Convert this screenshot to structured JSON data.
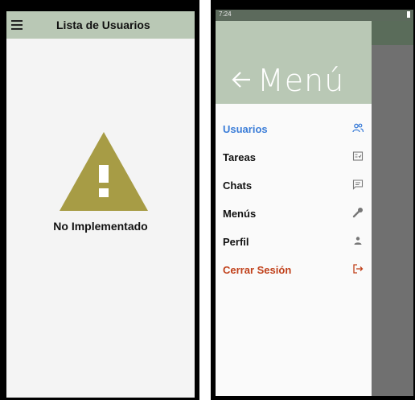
{
  "left_screen": {
    "title": "Lista de Usuarios",
    "message": "No Implementado",
    "warning_color": "#a79c45",
    "appbar_color": "#b9c8b5"
  },
  "right_screen": {
    "status_time": "7:24",
    "drawer_title": "Menú",
    "menu_items": [
      {
        "label": "Usuarios",
        "icon": "users-icon",
        "color": "#3b7dd8",
        "active": true
      },
      {
        "label": "Tareas",
        "icon": "task-list-icon",
        "color": "#111111"
      },
      {
        "label": "Chats",
        "icon": "chat-icon",
        "color": "#111111"
      },
      {
        "label": "Menús",
        "icon": "wrench-icon",
        "color": "#111111"
      },
      {
        "label": "Perfil",
        "icon": "person-icon",
        "color": "#111111"
      },
      {
        "label": "Cerrar Sesión",
        "icon": "logout-icon",
        "color": "#c0401a"
      }
    ]
  }
}
